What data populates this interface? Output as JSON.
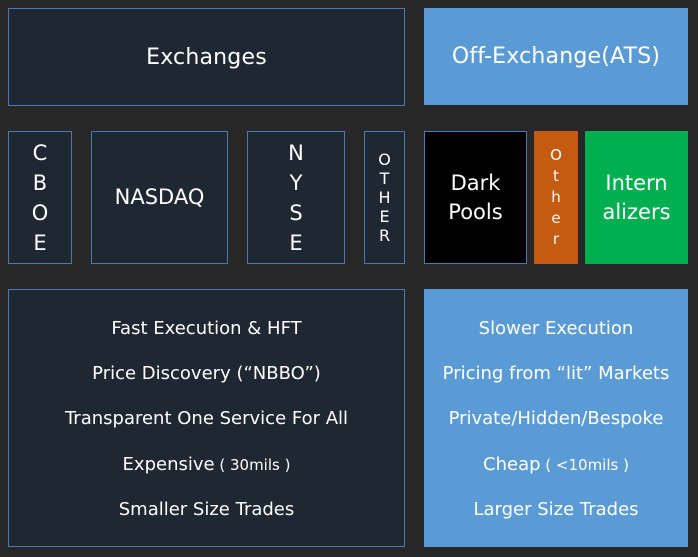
{
  "header": {
    "exchanges": "Exchanges",
    "off_exchange": "Off-Exchange(ATS)"
  },
  "venues": {
    "cboe": [
      "C",
      "B",
      "O",
      "E"
    ],
    "nasdaq": "NASDAQ",
    "nyse": [
      "N",
      "Y",
      "S",
      "E"
    ],
    "other_exchange": [
      "O",
      "T",
      "H",
      "E",
      "R"
    ],
    "dark_pools": [
      "Dark",
      "Pools"
    ],
    "other_ats": [
      "O",
      "t",
      "h",
      "e",
      "r"
    ],
    "internalizers": [
      "Intern",
      "alizers"
    ]
  },
  "exchanges_traits": [
    {
      "main": "Fast Execution & HFT",
      "sub": ""
    },
    {
      "main": "Price Discovery (“NBBO”)",
      "sub": ""
    },
    {
      "main": "Transparent One Service For All",
      "sub": ""
    },
    {
      "main": "Expensive",
      "sub": " ( 30mils )"
    },
    {
      "main": "Smaller Size Trades",
      "sub": ""
    }
  ],
  "ats_traits": [
    {
      "main": "Slower Execution",
      "sub": ""
    },
    {
      "main": "Pricing from “lit” Markets",
      "sub": ""
    },
    {
      "main": "Private/Hidden/Bespoke",
      "sub": ""
    },
    {
      "main": "Cheap",
      "sub": " ( <10mils )"
    },
    {
      "main": "Larger Size Trades",
      "sub": ""
    }
  ],
  "colors": {
    "background": "#272727",
    "exchange_box": "#1f2732",
    "exchange_border": "#4a78b0",
    "ats_box": "#5b9bd5",
    "dark_pools": "#000000",
    "other_ats": "#c55a11",
    "internalizers": "#00b050"
  }
}
